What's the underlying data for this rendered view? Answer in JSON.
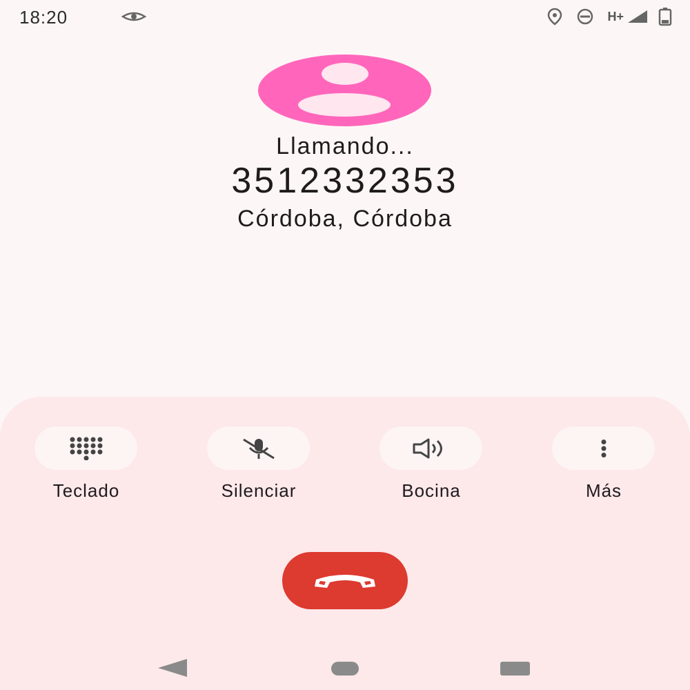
{
  "status_bar": {
    "time": "18:20",
    "network_label": "H+",
    "icons": [
      "eye-icon",
      "location-icon",
      "do-not-disturb-icon",
      "signal-icon",
      "battery-icon"
    ]
  },
  "call": {
    "status": "Llamando...",
    "number": "3512332353",
    "location": "Córdoba, Córdoba"
  },
  "actions": [
    {
      "label": "Teclado",
      "icon": "dialpad-icon"
    },
    {
      "label": "Silenciar",
      "icon": "mic-off-icon"
    },
    {
      "label": "Bocina",
      "icon": "speaker-icon"
    },
    {
      "label": "Más",
      "icon": "more-vert-icon"
    }
  ],
  "colors": {
    "background": "#fdf6f6",
    "panel": "#fde8ea",
    "avatar": "#ff66bb",
    "end_call": "#dd3a30"
  }
}
